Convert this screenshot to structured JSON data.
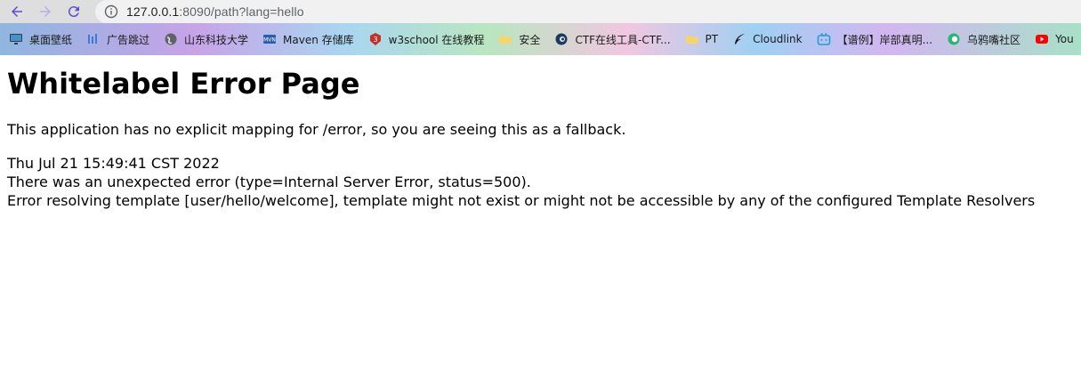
{
  "browser": {
    "url_host": "127.0.0.1",
    "url_rest": ":8090/path?lang=hello"
  },
  "bookmarks": [
    {
      "label": "桌面壁纸",
      "icon": "monitor-icon"
    },
    {
      "label": "广告跳过",
      "icon": "bars-icon"
    },
    {
      "label": "山东科技大学",
      "icon": "globe-icon"
    },
    {
      "label": "Maven 存储库",
      "icon": "mvn-icon"
    },
    {
      "label": "w3school 在线教程",
      "icon": "w3school-icon"
    },
    {
      "label": "安全",
      "icon": "folder-icon"
    },
    {
      "label": "CTF在线工具-CTF...",
      "icon": "ctf-icon"
    },
    {
      "label": "PT",
      "icon": "folder-icon"
    },
    {
      "label": "Cloudlink",
      "icon": "feather-icon"
    },
    {
      "label": "【谱例】岸部真明...",
      "icon": "bilibili-icon"
    },
    {
      "label": "乌鸦嘴社区",
      "icon": "crow-icon"
    },
    {
      "label": "You",
      "icon": "youtube-icon"
    }
  ],
  "page": {
    "title": "Whitelabel Error Page",
    "intro": "This application has no explicit mapping for /error, so you are seeing this as a fallback.",
    "timestamp": "Thu Jul 21 15:49:41 CST 2022",
    "error_line": "There was an unexpected error (type=Internal Server Error, status=500).",
    "detail_line": "Error resolving template [user/hello/welcome], template might not exist or might not be accessible by any of the configured Template Resolvers"
  },
  "colors": {
    "nav_back": "#5b4bd6",
    "nav_forward": "#b7b0e8",
    "nav_reload": "#5b4bd6"
  }
}
